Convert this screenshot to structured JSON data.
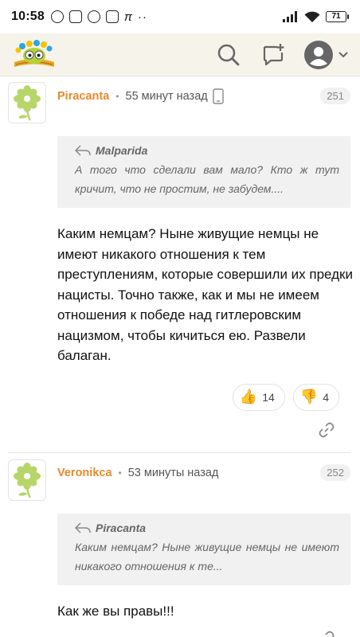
{
  "status_bar": {
    "time": "10:58",
    "battery": "71"
  },
  "header": {
    "logo_name": "app-logo"
  },
  "comments": [
    {
      "author": "Piracanta",
      "time": "55 минут назад",
      "number": "251",
      "quote_author": "Malparida",
      "quote_text": "А того что сделали вам мало? Кто ж тут кричит, что не простим, не забудем....",
      "body": "Каким немцам? Ныне живущие немцы не имеют никакого отношения к тем преступлениям, которые совершили их предки нацисты. Точно также, как и мы не имеем отношения к победе над гитлеровским нацизмом, чтобы кичиться ею. Развели балаган.",
      "likes": "14",
      "dislikes": "4"
    },
    {
      "author": "Veronikca",
      "time": "53 минуты назад",
      "number": "252",
      "quote_author": "Piracanta",
      "quote_text": "Каким немцам? Ныне живущие немцы не имеют никакого отношения к те...",
      "body": "Как же вы правы!!!"
    }
  ],
  "colors": {
    "author": "#e8892c",
    "header_bg": "#f5f3ea",
    "quote_bg": "#f1f1f1"
  }
}
